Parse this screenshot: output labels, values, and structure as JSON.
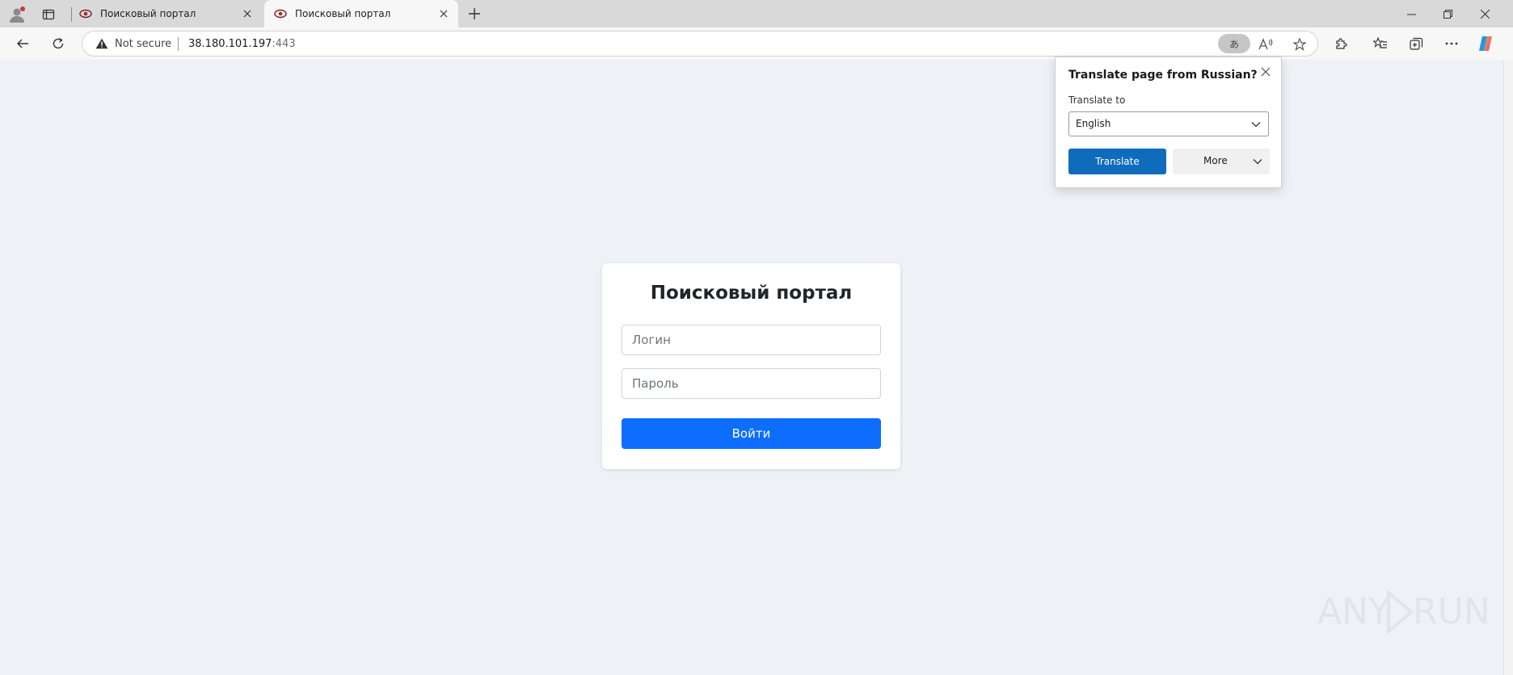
{
  "browser": {
    "tabs": [
      {
        "title": "Поисковый портал",
        "active": false
      },
      {
        "title": "Поисковый портал",
        "active": true
      }
    ],
    "address": {
      "security_label": "Not secure",
      "host": "38.180.101.197",
      "port": ":443"
    },
    "translate_pill": "あ"
  },
  "translate_popup": {
    "title": "Translate page from Russian?",
    "translate_to_label": "Translate to",
    "selected_language": "English",
    "translate_button": "Translate",
    "more_button": "More"
  },
  "login": {
    "title": "Поисковый портал",
    "login_placeholder": "Логин",
    "password_placeholder": "Пароль",
    "submit_label": "Войти"
  },
  "watermark": {
    "left": "ANY",
    "right": "RUN"
  },
  "colors": {
    "page_bg": "#eef1f5",
    "primary": "#0d6efd",
    "translate_blue": "#0f6cbd"
  }
}
